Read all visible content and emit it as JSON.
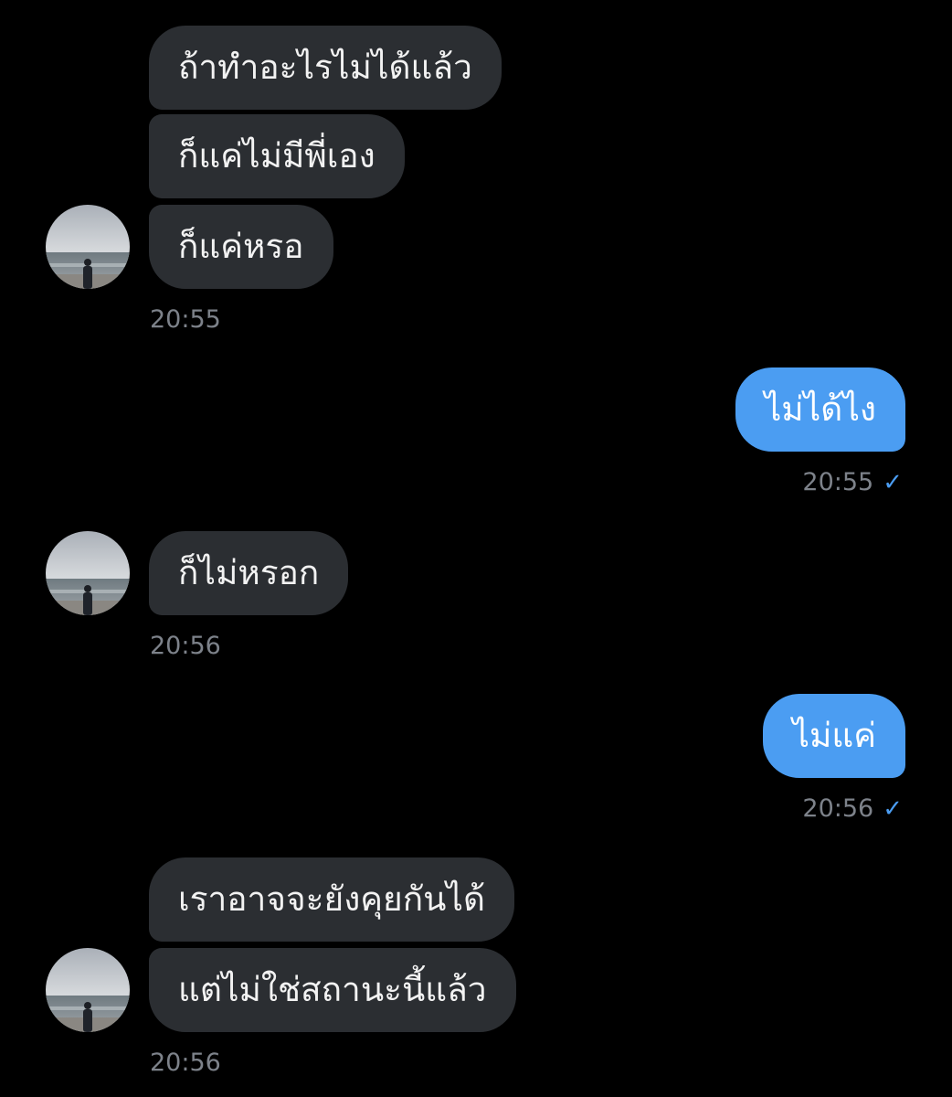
{
  "messages": [
    {
      "side": "incoming",
      "text": "ถ้าทำอะไรไม่ได้แล้ว"
    },
    {
      "side": "incoming",
      "text": "ก็แค่ไม่มีพี่เอง"
    },
    {
      "side": "incoming",
      "text": "ก็แค่หรอ"
    },
    {
      "side": "outgoing",
      "text": "ไม่ได้ไง"
    },
    {
      "side": "incoming",
      "text": "ก็ไม่หรอก"
    },
    {
      "side": "outgoing",
      "text": "ไม่แค่"
    },
    {
      "side": "incoming",
      "text": "เราอาจจะยังคุยกันได้"
    },
    {
      "side": "incoming",
      "text": "แต่ไม่ใช่สถานะนี้แล้ว"
    }
  ],
  "timestamps": [
    "20:55",
    "20:55",
    "20:56",
    "20:56",
    "20:56"
  ],
  "read_receipt_icon": "checkmark-icon",
  "avatar_icon": "beach-person-photo",
  "colors": {
    "background": "#000000",
    "incoming_bubble": "#2b2e32",
    "outgoing_bubble": "#4b9df2",
    "timestamp": "#7d828a"
  }
}
